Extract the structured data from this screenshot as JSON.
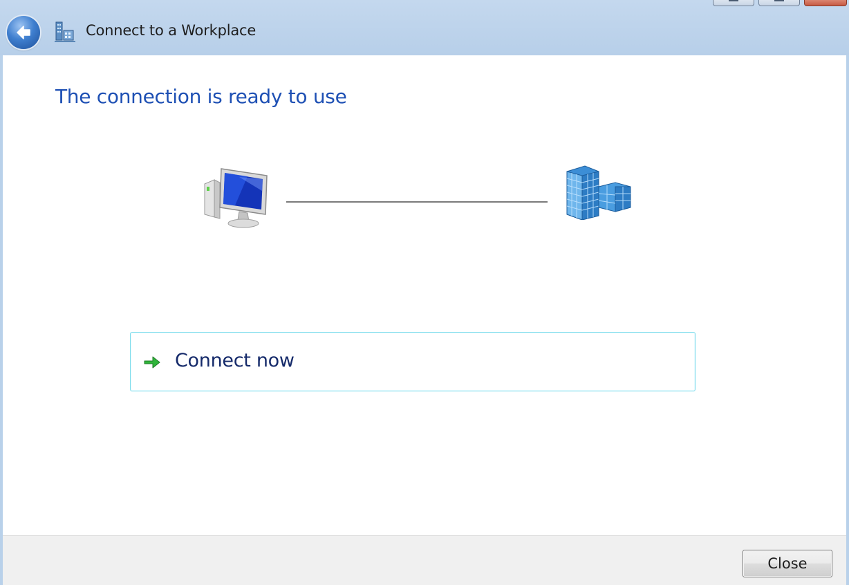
{
  "window": {
    "title": "Connect to a Workplace"
  },
  "main": {
    "heading": "The connection is ready to use",
    "connect_label": "Connect now"
  },
  "footer": {
    "close_label": "Close"
  },
  "icons": {
    "back": "back-arrow-icon",
    "title": "workplace-network-icon",
    "computer": "computer-icon",
    "building": "building-icon",
    "connect_arrow": "green-arrow-icon"
  },
  "colors": {
    "heading": "#1e50b4",
    "link_border": "#7fdcec",
    "titlebar": "#b9d1ea"
  }
}
